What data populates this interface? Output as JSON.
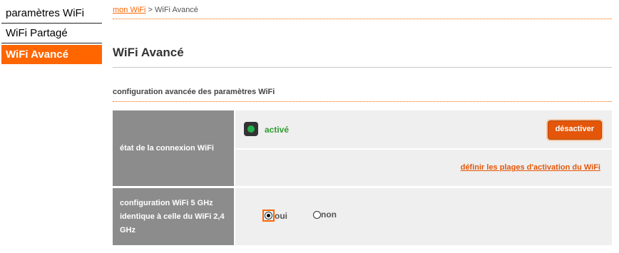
{
  "sidebar": {
    "items": [
      {
        "label": "paramètres WiFi"
      },
      {
        "label": "WiFi Partagé"
      },
      {
        "label": "WiFi Avancé",
        "active": true
      }
    ]
  },
  "breadcrumb": {
    "link": "mon WiFi",
    "separator": " > ",
    "current": "WiFi Avancé"
  },
  "page": {
    "title": "WiFi Avancé",
    "section_title": "configuration avancée des paramètres WiFi"
  },
  "wifi_state": {
    "label": "état de la connexion WiFi",
    "status_icon": "green-dot-icon",
    "status": "activé",
    "button": "désactiver",
    "link": "définir les plages d'activation du WiFi"
  },
  "config_5ghz": {
    "label": "configuration WiFi 5 GHz identique à celle du WiFi 2,4 GHz",
    "options": [
      {
        "label": "oui",
        "checked": true
      },
      {
        "label": "non",
        "checked": false
      }
    ]
  },
  "colors": {
    "accent": "#ff6600",
    "label_bg": "#8c8c8c",
    "value_bg": "#efefef",
    "status_green": "#2e9b2e"
  }
}
